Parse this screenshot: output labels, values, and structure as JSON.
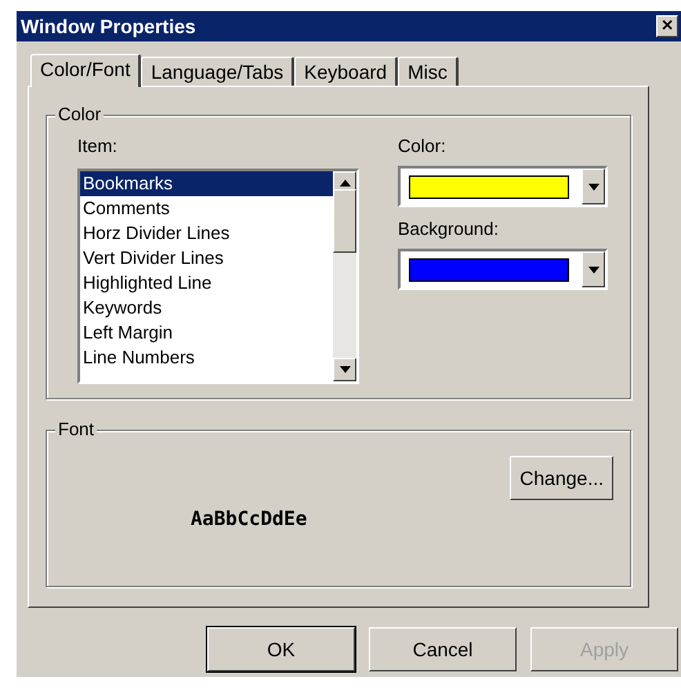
{
  "window": {
    "title": "Window Properties",
    "close": "✕"
  },
  "tabs": [
    {
      "label": "Color/Font",
      "selected": true
    },
    {
      "label": "Language/Tabs",
      "selected": false
    },
    {
      "label": "Keyboard",
      "selected": false
    },
    {
      "label": "Misc",
      "selected": false
    }
  ],
  "color_group": {
    "title": "Color",
    "item_label": "Item:",
    "items": [
      {
        "label": "Bookmarks",
        "selected": true
      },
      {
        "label": "Comments",
        "selected": false
      },
      {
        "label": "Horz Divider Lines",
        "selected": false
      },
      {
        "label": "Vert Divider Lines",
        "selected": false
      },
      {
        "label": "Highlighted Line",
        "selected": false
      },
      {
        "label": "Keywords",
        "selected": false
      },
      {
        "label": "Left Margin",
        "selected": false
      },
      {
        "label": "Line Numbers",
        "selected": false
      }
    ],
    "pickers": [
      {
        "label": "Color:",
        "color": "#ffff00"
      },
      {
        "label": "Background:",
        "color": "#0000ff"
      }
    ]
  },
  "font_group": {
    "title": "Font",
    "change_button": "Change...",
    "sample": "AaBbCcDdEe"
  },
  "buttons": [
    {
      "label": "OK",
      "default": true,
      "disabled": false
    },
    {
      "label": "Cancel",
      "default": false,
      "disabled": false
    },
    {
      "label": "Apply",
      "default": false,
      "disabled": true
    }
  ]
}
